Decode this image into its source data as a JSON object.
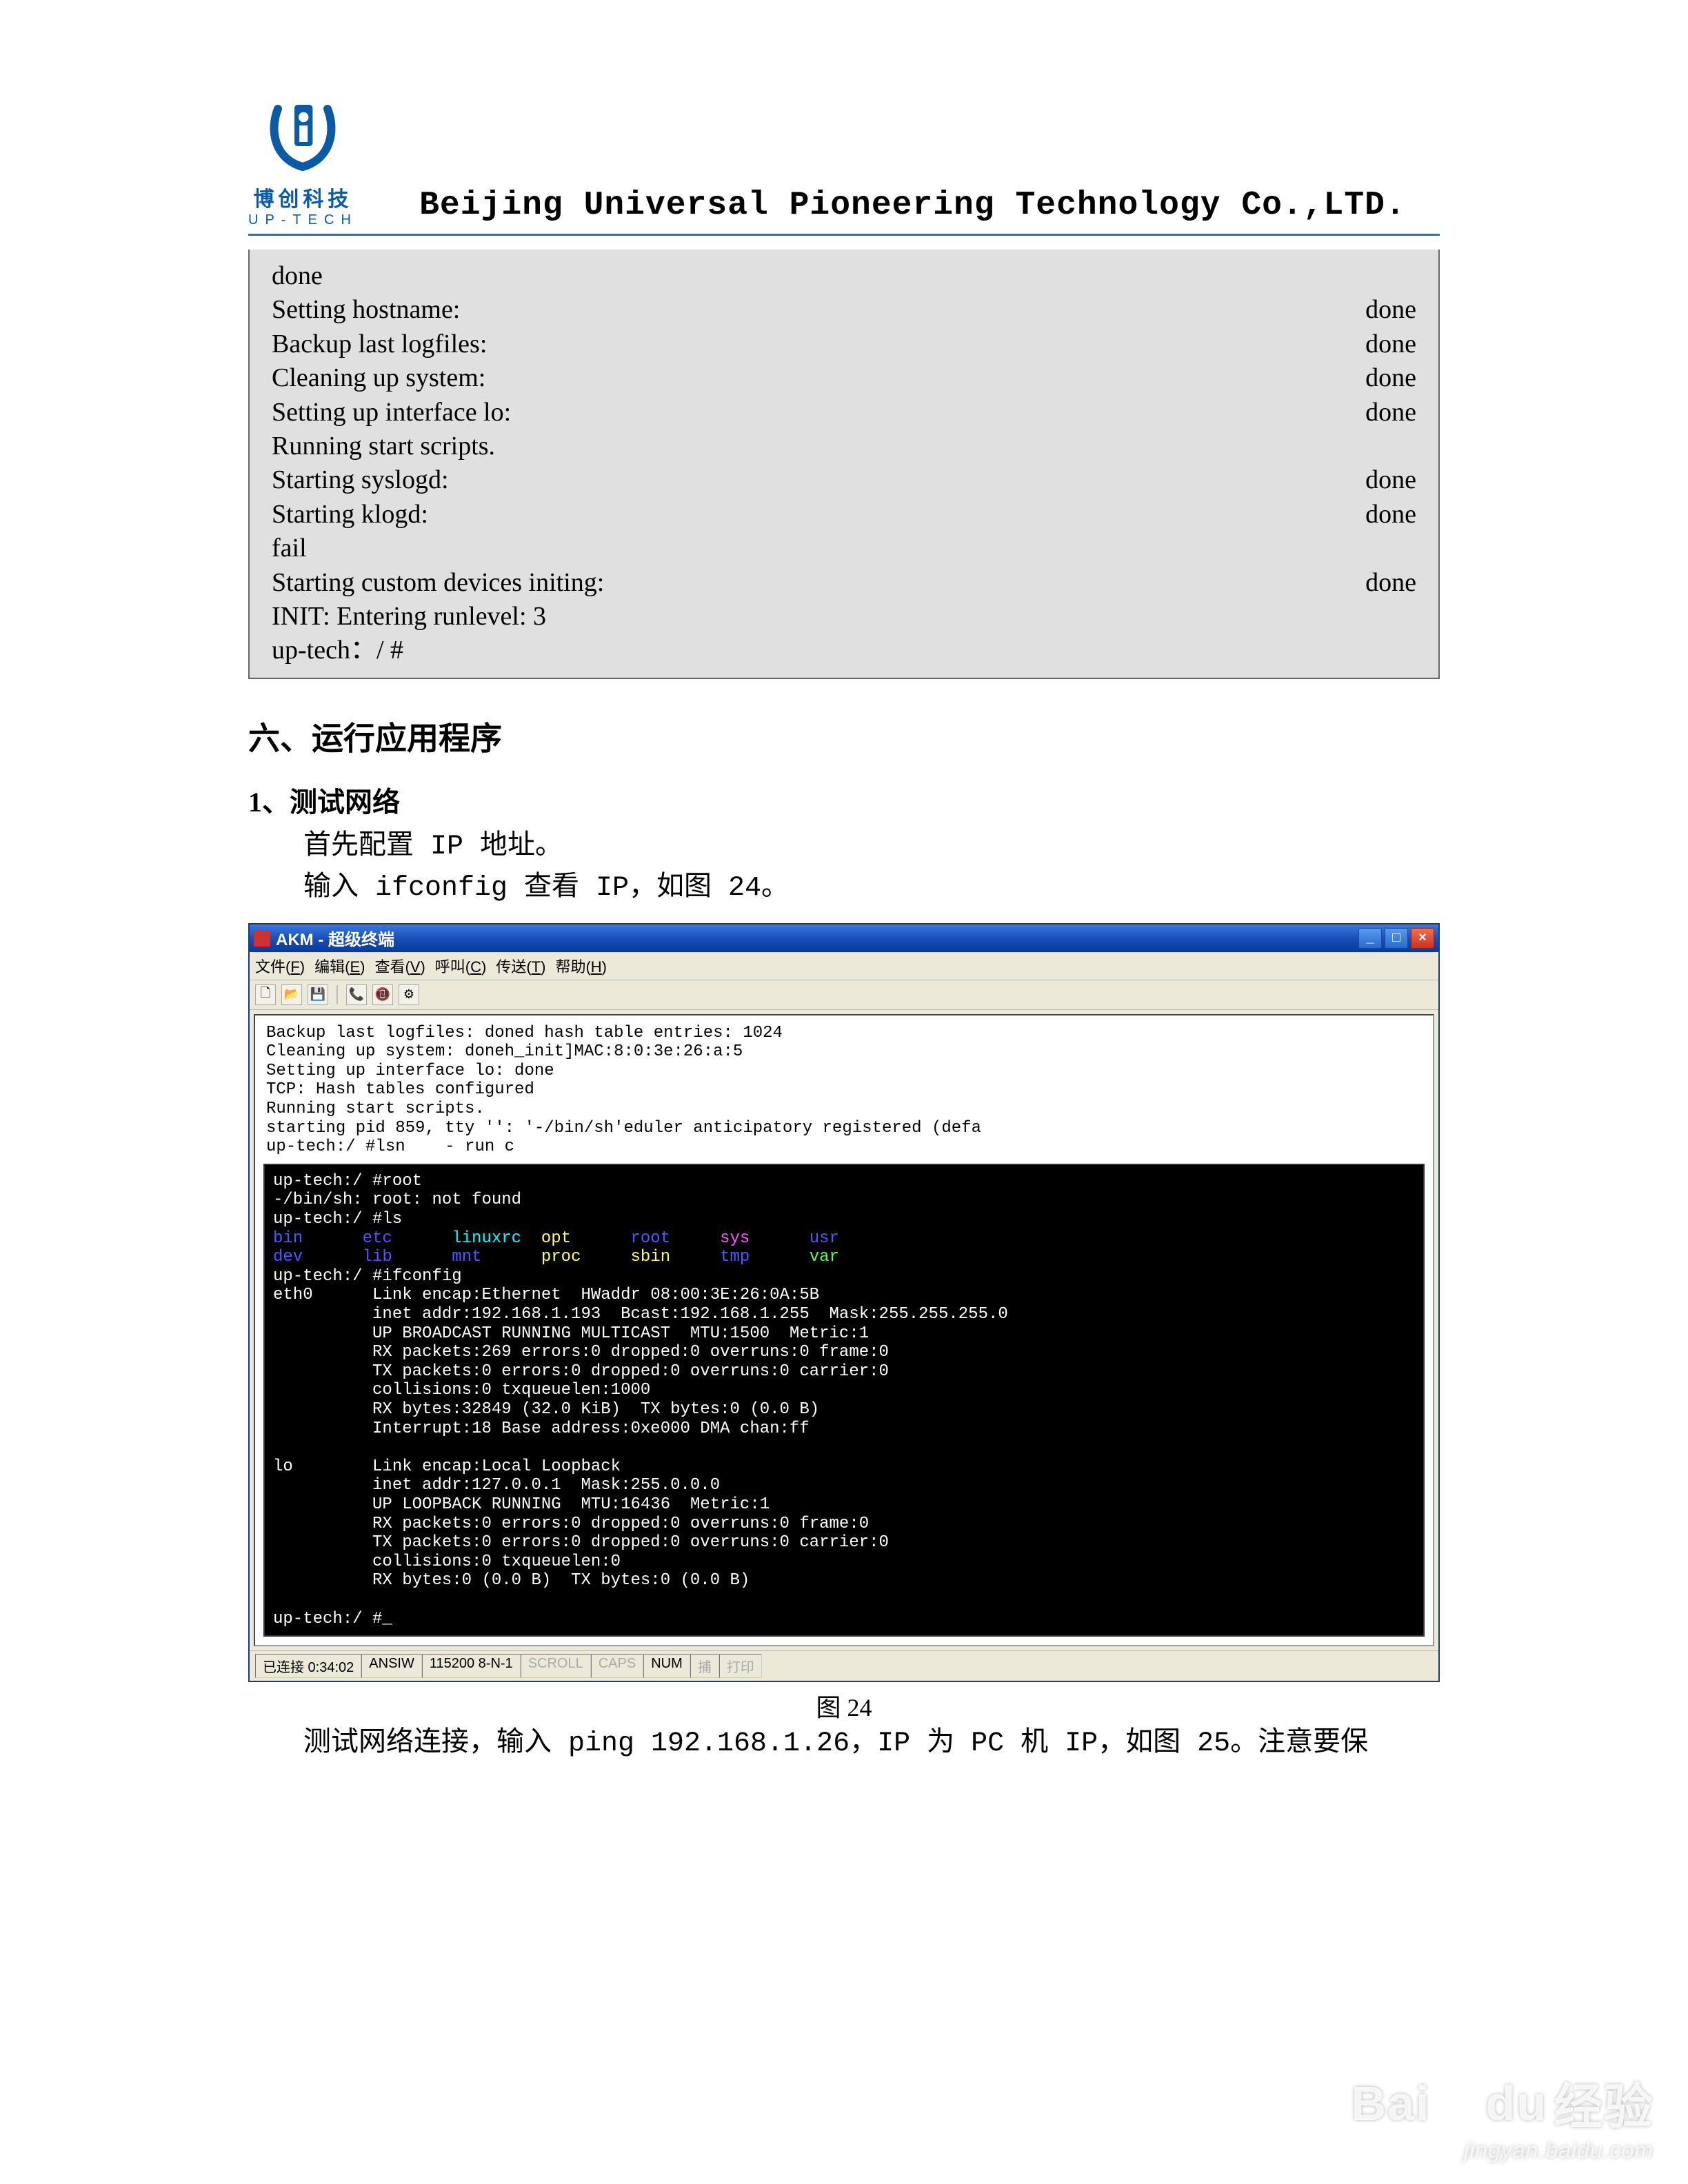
{
  "header": {
    "logo_cn": "博创科技",
    "logo_en": "UP-TECH",
    "company": "Beijing Universal Pioneering Technology Co.,LTD."
  },
  "boot": {
    "rows": [
      {
        "l": "done",
        "r": ""
      },
      {
        "l": "Setting hostname:",
        "r": "done"
      },
      {
        "l": "Backup last logfiles:",
        "r": "done"
      },
      {
        "l": "Cleaning up system:",
        "r": "done"
      },
      {
        "l": "Setting up interface lo:",
        "r": "done"
      },
      {
        "l": "Running start scripts.",
        "r": ""
      },
      {
        "l": "Starting syslogd:",
        "r": "done"
      },
      {
        "l": "Starting klogd:",
        "r": "done"
      },
      {
        "l": "",
        "r": ""
      },
      {
        "l": "fail",
        "r": ""
      },
      {
        "l": "Starting custom devices initing:",
        "r": "done"
      },
      {
        "l": "INIT: Entering runlevel: 3",
        "r": ""
      },
      {
        "l": "up-tech：/ #",
        "r": ""
      }
    ]
  },
  "section": {
    "heading": "六、运行应用程序",
    "sub1": "1、测试网络",
    "p1": "首先配置 IP 地址。",
    "p2": "输入 ifconfig 查看 IP，如图 24。",
    "fig_caption": "图 24",
    "p3": "测试网络连接，输入 ping 192.168.1.26，IP 为 PC 机 IP，如图 25。注意要保"
  },
  "terminal": {
    "title": "AKM - 超级终端",
    "menus": [
      "文件(F)",
      "编辑(E)",
      "查看(V)",
      "呼叫(C)",
      "传送(T)",
      "帮助(H)"
    ],
    "top_lines": [
      "Backup last logfiles: doned hash table entries: 1024",
      "Cleaning up system: doneh_init]MAC:8:0:3e:26:a:5",
      "Setting up interface lo: done",
      "TCP: Hash tables configured",
      "Running start scripts.",
      "starting pid 859, tty '': '-/bin/sh'eduler anticipatory registered (defa",
      "up-tech:/ #lsn    - run c"
    ],
    "black": {
      "l1": "up-tech:/ #root",
      "l2": "-/bin/sh: root: not found",
      "l3": "up-tech:/ #ls",
      "ls_row1": {
        "bin": "bin",
        "etc": "etc",
        "linuxrc": "linuxrc",
        "opt": "opt",
        "root": "root",
        "sys": "sys",
        "usr": "usr"
      },
      "ls_row2": {
        "dev": "dev",
        "lib": "lib",
        "mnt": "mnt",
        "proc": "proc",
        "sbin": "sbin",
        "tmp": "tmp",
        "var": "var"
      },
      "l4": "up-tech:/ #ifconfig",
      "eth0": [
        "eth0      Link encap:Ethernet  HWaddr 08:00:3E:26:0A:5B",
        "          inet addr:192.168.1.193  Bcast:192.168.1.255  Mask:255.255.255.0",
        "          UP BROADCAST RUNNING MULTICAST  MTU:1500  Metric:1",
        "          RX packets:269 errors:0 dropped:0 overruns:0 frame:0",
        "          TX packets:0 errors:0 dropped:0 overruns:0 carrier:0",
        "          collisions:0 txqueuelen:1000",
        "          RX bytes:32849 (32.0 KiB)  TX bytes:0 (0.0 B)",
        "          Interrupt:18 Base address:0xe000 DMA chan:ff"
      ],
      "lo": [
        "lo        Link encap:Local Loopback",
        "          inet addr:127.0.0.1  Mask:255.0.0.0",
        "          UP LOOPBACK RUNNING  MTU:16436  Metric:1",
        "          RX packets:0 errors:0 dropped:0 overruns:0 frame:0",
        "          TX packets:0 errors:0 dropped:0 overruns:0 carrier:0",
        "          collisions:0 txqueuelen:0",
        "          RX bytes:0 (0.0 B)  TX bytes:0 (0.0 B)"
      ],
      "prompt": "up-tech:/ #_"
    },
    "status": {
      "conn": "已连接 0:34:02",
      "term": "ANSIW",
      "baud": "115200 8-N-1",
      "scroll": "SCROLL",
      "caps": "CAPS",
      "num": "NUM",
      "cap2": "捕",
      "print": "打印"
    }
  },
  "watermark": {
    "main_en": "Bai",
    "main_en2": "du",
    "main_cn": "经验",
    "sub": "jingyan.baidu.com"
  }
}
